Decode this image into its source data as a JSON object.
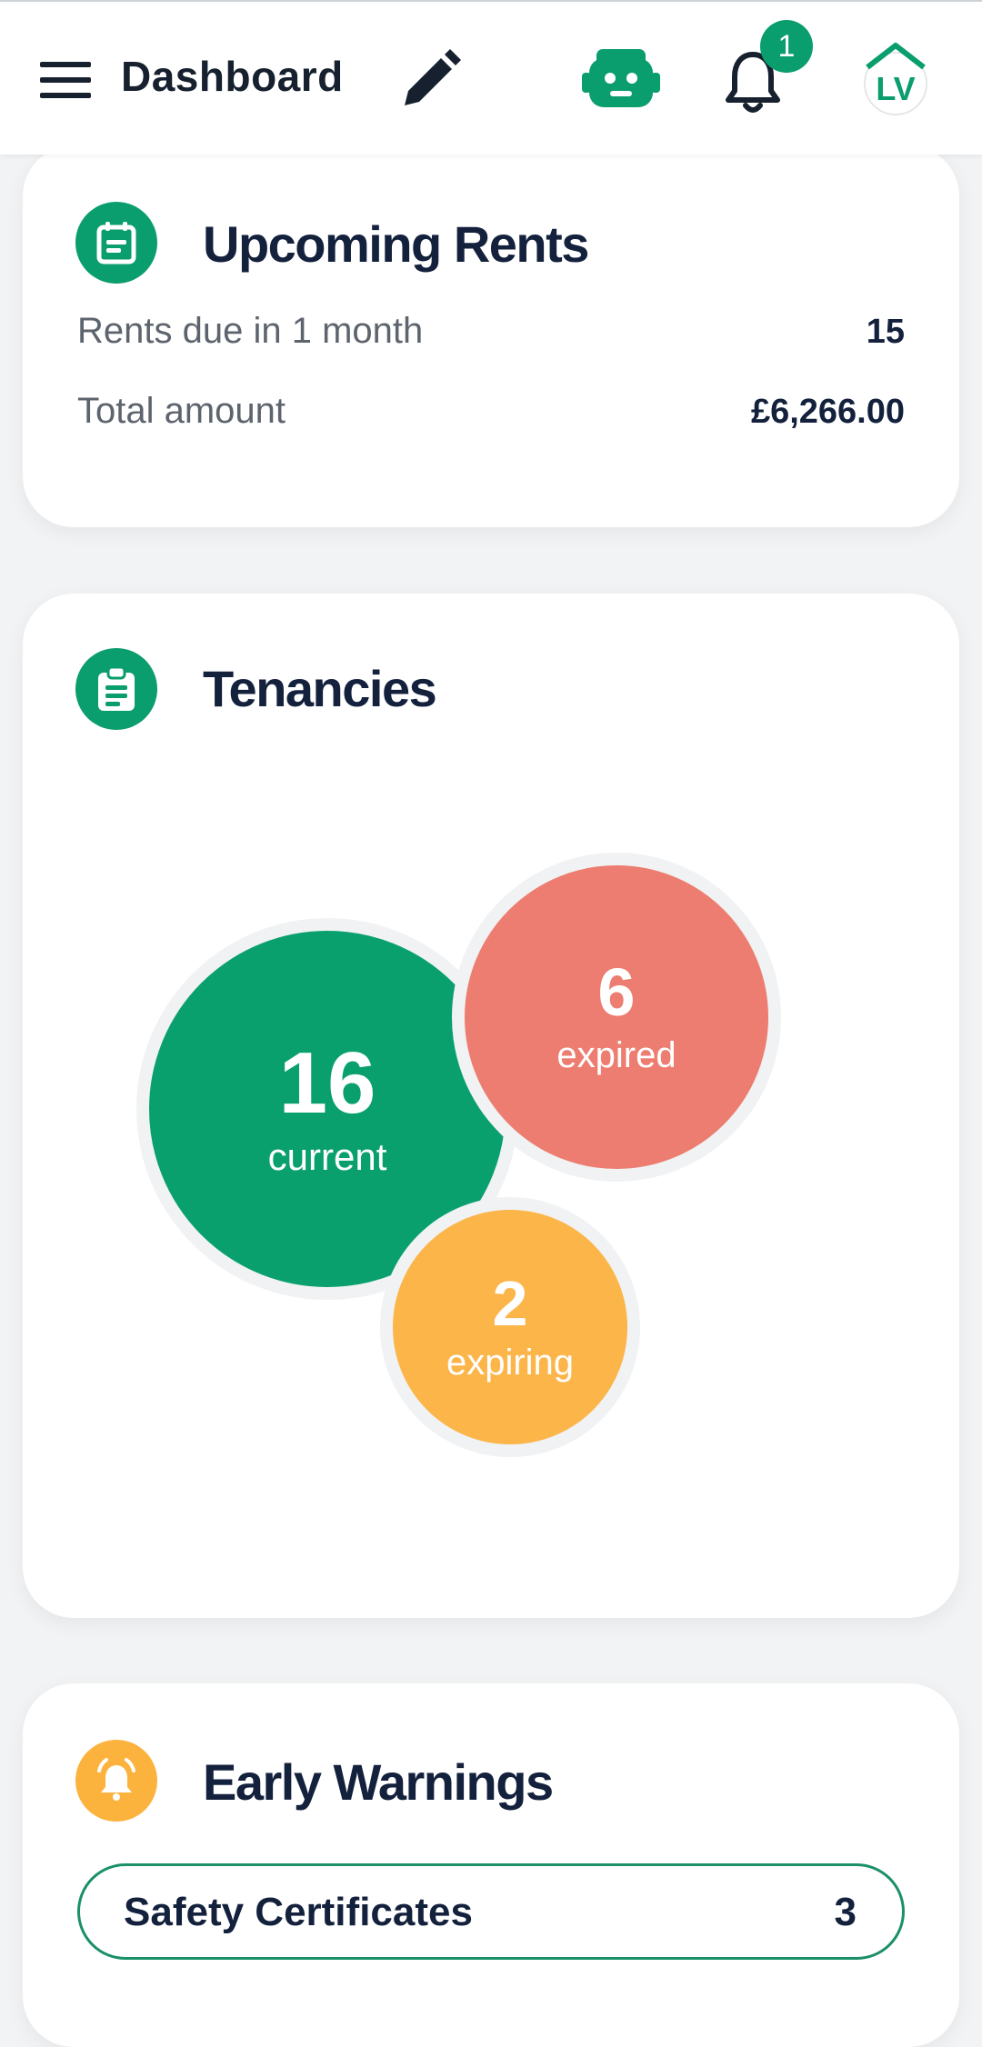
{
  "header": {
    "title": "Dashboard",
    "notification_count": "1",
    "icons": [
      "menu-icon",
      "pencil-icon",
      "robot-icon",
      "bell-icon",
      "avatar-logo"
    ],
    "avatar_text": "LV"
  },
  "upcoming_rents": {
    "title": "Upcoming Rents",
    "rows": [
      {
        "label": "Rents due in 1 month",
        "value": "15"
      },
      {
        "label": "Total amount",
        "value": "£6,266.00"
      }
    ]
  },
  "tenancies": {
    "title": "Tenancies",
    "bubbles": [
      {
        "count": "16",
        "label": "current",
        "color": "#0aa06e"
      },
      {
        "count": "6",
        "label": "expired",
        "color": "#ec7d70"
      },
      {
        "count": "2",
        "label": "expiring",
        "color": "#fbb549"
      }
    ]
  },
  "early_warnings": {
    "title": "Early Warnings",
    "items": [
      {
        "label": "Safety Certificates",
        "count": "3"
      }
    ]
  },
  "colors": {
    "accent": "#0a9d6e",
    "warning": "#fbb33e",
    "text": "#14213d",
    "background": "#f2f3f5"
  }
}
